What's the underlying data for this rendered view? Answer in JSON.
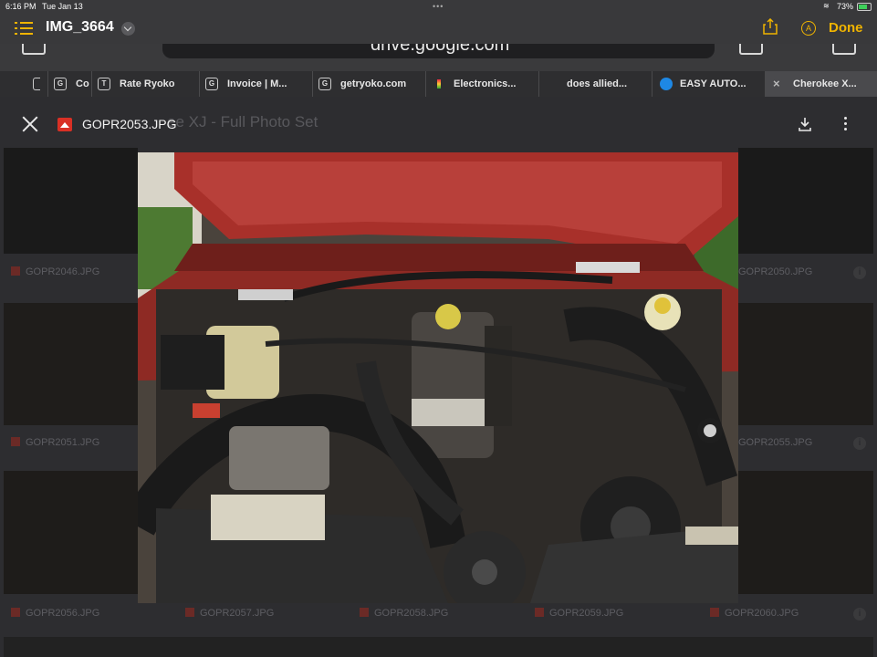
{
  "status_bar": {
    "time": "6:16 PM",
    "date": "Tue Jan 13",
    "battery": "73%"
  },
  "app_header": {
    "title": "IMG_3664",
    "done_label": "Done",
    "list_icon": "list-icon",
    "share_icon": "share-icon",
    "markup_icon": "markup-icon"
  },
  "browser": {
    "url": "drive.google.com"
  },
  "tabs": [
    {
      "label": "Co",
      "favicon": "G"
    },
    {
      "label": "Rate Ryoko",
      "favicon": "T"
    },
    {
      "label": "Invoice | M...",
      "favicon": "G"
    },
    {
      "label": "getryoko.com",
      "favicon": "G"
    },
    {
      "label": "Electronics...",
      "favicon": ""
    },
    {
      "label": "does allied...",
      "favicon": ""
    },
    {
      "label": "EASY AUTO...",
      "favicon": ""
    },
    {
      "label": "Cherokee X...",
      "favicon": "×"
    }
  ],
  "viewer": {
    "background_heading": "ee XJ - Full Photo Set",
    "file_name": "GOPR2053.JPG",
    "close_icon": "close-icon",
    "download_icon": "download-icon",
    "more_icon": "more-vert-icon"
  },
  "thumbnails": {
    "row1": [
      "GOPR2046.JPG",
      "GOPR2050.JPG"
    ],
    "row2": [
      "GOPR2051.JPG",
      "GOPR2055.JPG"
    ],
    "row3": [
      "GOPR2056.JPG",
      "GOPR2057.JPG",
      "GOPR2058.JPG",
      "GOPR2059.JPG",
      "GOPR2060.JPG"
    ]
  }
}
